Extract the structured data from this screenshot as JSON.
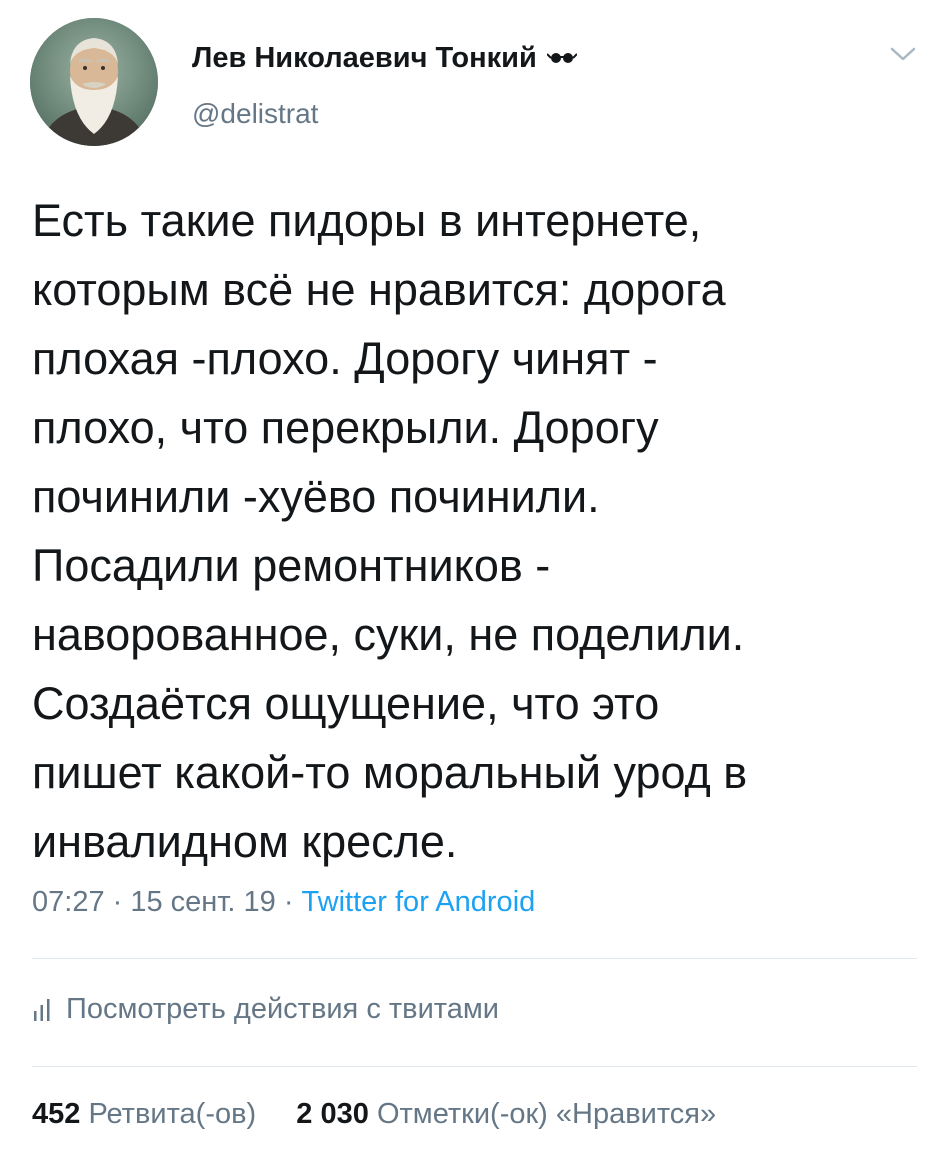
{
  "author": {
    "name": "Лев Николаевич Тонкий",
    "handle": "@delistrat",
    "avatar_icon": "avatar-portrait",
    "name_emoji_icon": "eyeglasses-icon"
  },
  "menu": {
    "icon": "chevron-down-icon"
  },
  "tweet": {
    "lines": [
      "Есть такие пидоры в интернете,",
      "которым всё не нравится: дорога",
      "плохая -плохо. Дорогу чинят -",
      "плохо, что перекрыли. Дорогу",
      "починили -хуёво починили.",
      "Посадили ремонтников -",
      "наворованное, суки, не поделили.",
      "Создаётся ощущение, что это",
      "пишет какой-то моральный урод в",
      "инвалидном кресле."
    ]
  },
  "meta": {
    "time": "07:27",
    "separator": " · ",
    "date": "15 сент. 19",
    "source": "Twitter for Android"
  },
  "activity": {
    "label": "Посмотреть действия с твитами",
    "icon": "bar-chart-icon"
  },
  "stats": {
    "retweets_count": "452",
    "retweets_label": "Ретвита(-ов)",
    "likes_count": "2 030",
    "likes_label": "Отметки(-ок) «Нравится»"
  },
  "colors": {
    "text_primary": "#14171a",
    "text_secondary": "#657786",
    "link": "#1da1f2",
    "divider": "#e1e8ed"
  }
}
